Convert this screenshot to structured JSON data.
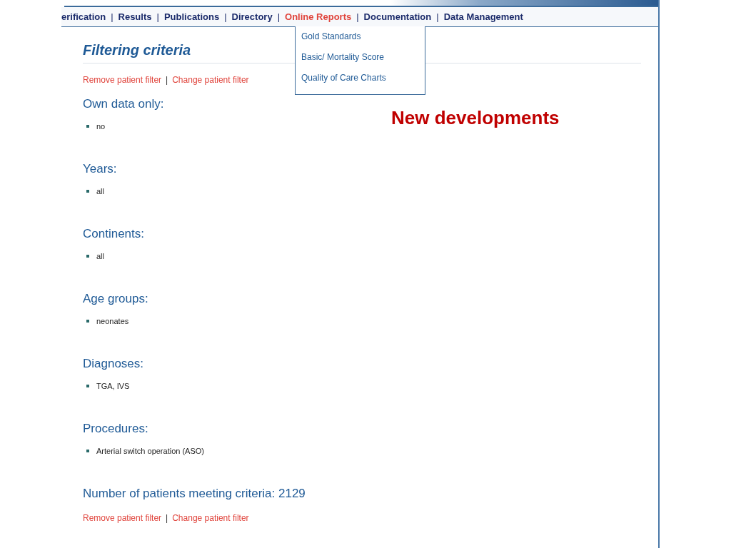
{
  "nav": [
    {
      "label": "erification",
      "selected": false
    },
    {
      "label": "Results",
      "selected": false
    },
    {
      "label": "Publications",
      "selected": false
    },
    {
      "label": "Directory",
      "selected": false
    },
    {
      "label": "Online Reports",
      "selected": true
    },
    {
      "label": "Documentation",
      "selected": false
    },
    {
      "label": "Data Management",
      "selected": false
    }
  ],
  "nav_separator": "|",
  "dropdown": [
    "Gold Standards",
    "Basic/ Mortality Score",
    "Quality of Care Charts"
  ],
  "title": "Filtering criteria",
  "filter_links": [
    "Remove patient filter",
    "Change patient filter"
  ],
  "sections": [
    {
      "heading": "Own data only:",
      "items": [
        "no"
      ]
    },
    {
      "heading": "Years:",
      "items": [
        "all"
      ]
    },
    {
      "heading": "Continents:",
      "items": [
        "all"
      ]
    },
    {
      "heading": "Age groups:",
      "items": [
        "neonates"
      ]
    },
    {
      "heading": "Diagnoses:",
      "items": [
        "TGA, IVS"
      ]
    },
    {
      "heading": "Procedures:",
      "items": [
        "Arterial switch operation (ASO)"
      ]
    }
  ],
  "patients_count": "Number of patients meeting criteria: 2129",
  "bottom_links": [
    "Remove patient filter",
    "Change patient filter"
  ],
  "annotation": "New developments"
}
